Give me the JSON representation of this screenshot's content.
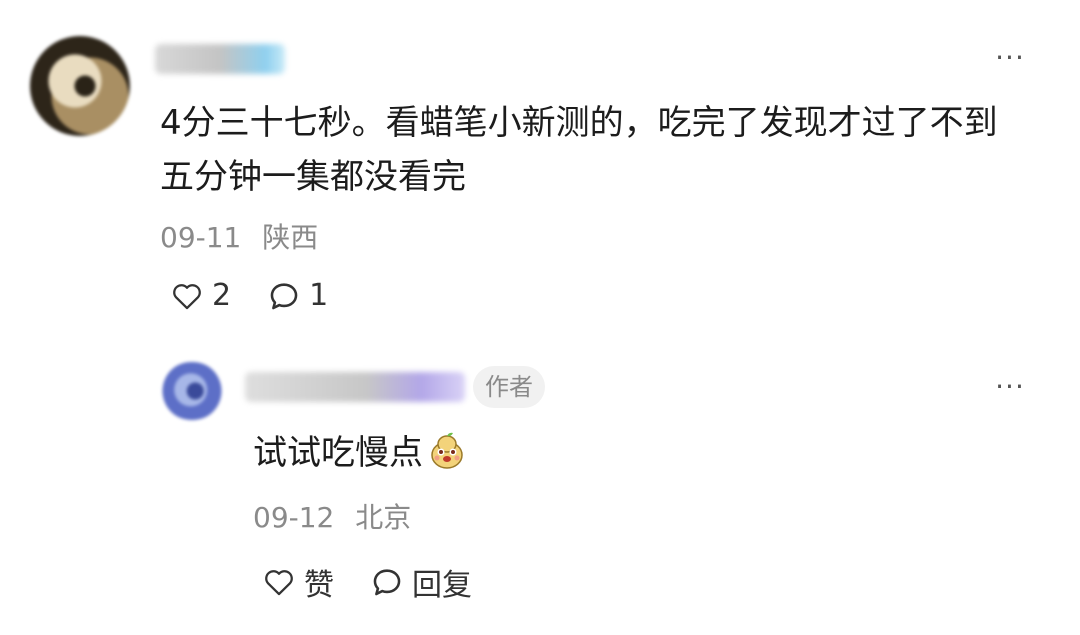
{
  "comments": [
    {
      "text": "4分三十七秒。看蜡笔小新测的，吃完了发现才过了不到五分钟一集都没看完",
      "date": "09-11",
      "location": "陕西",
      "likes": "2",
      "replies": "1",
      "more": "···"
    }
  ],
  "reply": {
    "author_tag": "作者",
    "text": "试试吃慢点",
    "emoji": "pear-face-emoji",
    "date": "09-12",
    "location": "北京",
    "like_label": "赞",
    "reply_label": "回复",
    "more": "···"
  },
  "icons": {
    "like": "heart-outline-icon",
    "comment": "comment-bubble-icon",
    "more": "more-dots-icon"
  },
  "colors": {
    "text": "#1c1c1c",
    "meta": "#8a8a8a",
    "tag_bg": "#f1f1f1"
  }
}
